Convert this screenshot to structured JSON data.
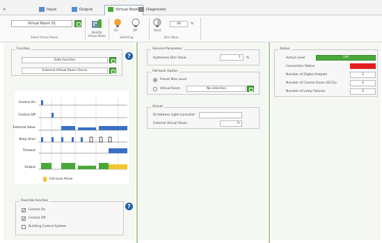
{
  "tabs": [
    {
      "label": "Input",
      "active": false
    },
    {
      "label": "Output",
      "active": false
    },
    {
      "label": "Virtual Room",
      "active": true
    },
    {
      "label": "Diagnostic",
      "active": false
    }
  ],
  "ribbon": {
    "room_select": {
      "value": "Virtual Room 01",
      "group_label": "Select Virtual Room"
    },
    "virtual_room_btn": "Identify\nVirtual Room",
    "on_label": "On",
    "off_label": "Off",
    "switching_label": "Switching",
    "send_label": "Send",
    "dim_value": "44",
    "dim_unit": "%",
    "dim_label": "Dim Value"
  },
  "function_box": {
    "title": "Function",
    "dropdown1": "Gate function",
    "dropdown2": "External Virtual Room Clever"
  },
  "diagram": {
    "signals": [
      "Central On",
      "Central Off",
      "External Value",
      "Keep Alive",
      "Timeout",
      "Output"
    ],
    "legend": "Fall-back Mode"
  },
  "override_box": {
    "title": "Override function",
    "items": [
      {
        "label": "Central On",
        "checked": true
      },
      {
        "label": "Central Off",
        "checked": true
      },
      {
        "label": "Building Control System",
        "checked": false
      }
    ]
  },
  "general_box": {
    "title": "General Parameter",
    "hysteresis_label": "Hysteresis Dim Value",
    "hysteresis_value": "1",
    "hysteresis_unit": "%"
  },
  "fallback_box": {
    "title": "Fall-back Option",
    "opt1": "Preset Max Level",
    "opt2": "Virtual Room",
    "opt2_value": "No selection"
  },
  "virtual_box": {
    "title": "Virtual",
    "address_label": "DI Address Light Controller",
    "address_value": "",
    "ext_label": "External Virtual Room",
    "ext_value": "0"
  },
  "status_box": {
    "title": "Status",
    "rows": [
      {
        "label": "Actual Level",
        "value": "100"
      },
      {
        "label": "Connection Status",
        "value": ""
      },
      {
        "label": "Number of Digital Outputs",
        "value": "2"
      },
      {
        "label": "Number of Control Gears (ECG)s",
        "value": "4"
      },
      {
        "label": "Number of Lamp Failures",
        "value": "0"
      }
    ]
  },
  "colors": {
    "accent_green": "#49a83a",
    "status_red": "#e21e1e",
    "diagram_blue": "#3a6fc4",
    "diagram_yellow": "#f2c531",
    "help_blue": "#1f5fa8"
  }
}
